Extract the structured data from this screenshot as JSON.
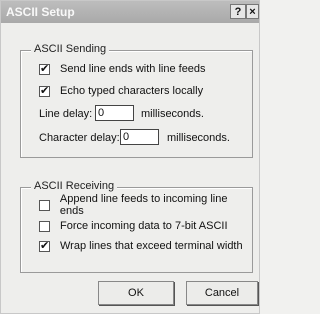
{
  "window": {
    "title": "ASCII Setup",
    "help_label": "?",
    "close_label": "×"
  },
  "sending": {
    "legend": "ASCII Sending",
    "send_line_ends": {
      "label": "Send line ends with line feeds",
      "checked": true,
      "mark": "✔"
    },
    "echo_typed": {
      "label": "Echo typed characters locally",
      "checked": true,
      "mark": "✔"
    },
    "line_delay": {
      "label": "Line delay:",
      "value": "0",
      "unit": "milliseconds."
    },
    "char_delay": {
      "label": "Character delay:",
      "value": "0",
      "unit": "milliseconds."
    }
  },
  "receiving": {
    "legend": "ASCII Receiving",
    "append_line_feeds": {
      "label": "Append line feeds to incoming line ends",
      "checked": false,
      "mark": ""
    },
    "force_7bit": {
      "label": "Force incoming data to 7-bit ASCII",
      "checked": false,
      "mark": ""
    },
    "wrap_lines": {
      "label": "Wrap lines that exceed terminal width",
      "checked": true,
      "mark": "✔"
    }
  },
  "buttons": {
    "ok": "OK",
    "cancel": "Cancel"
  }
}
